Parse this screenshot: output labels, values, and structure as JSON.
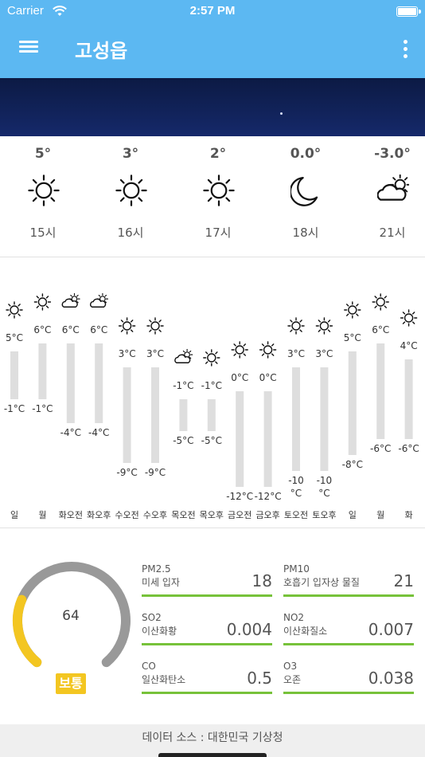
{
  "status": {
    "carrier": "Carrier",
    "time": "2:57 PM"
  },
  "header": {
    "title": "고성읍"
  },
  "hourly": [
    {
      "temp": "5°",
      "icon": "sun-icon",
      "time": "15시"
    },
    {
      "temp": "3°",
      "icon": "sun-icon",
      "time": "16시"
    },
    {
      "temp": "2°",
      "icon": "sun-icon",
      "time": "17시"
    },
    {
      "temp": "0.0°",
      "icon": "moon-icon",
      "time": "18시"
    },
    {
      "temp": "-3.0°",
      "icon": "cloud-sun-icon",
      "time": "21시"
    }
  ],
  "weekly": [
    {
      "label": "일",
      "max": 5,
      "min": -1,
      "max_text": "5°C",
      "min_text": "-1°C",
      "icon": "sun-icon"
    },
    {
      "label": "월",
      "max": 6,
      "min": -1,
      "max_text": "6°C",
      "min_text": "-1°C",
      "icon": "sun-icon"
    },
    {
      "label": "화오전",
      "max": 6,
      "min": -4,
      "max_text": "6°C",
      "min_text": "-4°C",
      "icon": "cloud-sun-icon"
    },
    {
      "label": "화오후",
      "max": 6,
      "min": -4,
      "max_text": "6°C",
      "min_text": "-4°C",
      "icon": "cloud-sun-icon"
    },
    {
      "label": "수오전",
      "max": 3,
      "min": -9,
      "max_text": "3°C",
      "min_text": "-9°C",
      "icon": "sun-icon"
    },
    {
      "label": "수오후",
      "max": 3,
      "min": -9,
      "max_text": "3°C",
      "min_text": "-9°C",
      "icon": "sun-icon"
    },
    {
      "label": "목오전",
      "max": -1,
      "min": -5,
      "max_text": "-1°C",
      "min_text": "-5°C",
      "icon": "cloud-sun-icon"
    },
    {
      "label": "목오후",
      "max": -1,
      "min": -5,
      "max_text": "-1°C",
      "min_text": "-5°C",
      "icon": "sun-icon"
    },
    {
      "label": "금오전",
      "max": 0,
      "min": -12,
      "max_text": "0°C",
      "min_text": "-12°C",
      "icon": "sun-icon"
    },
    {
      "label": "금오후",
      "max": 0,
      "min": -12,
      "max_text": "0°C",
      "min_text": "-12°C",
      "icon": "sun-icon"
    },
    {
      "label": "토오전",
      "max": 3,
      "min": -10,
      "max_text": "3°C",
      "min_text": "-10 °C",
      "icon": "sun-icon"
    },
    {
      "label": "토오후",
      "max": 3,
      "min": -10,
      "max_text": "3°C",
      "min_text": "-10 °C",
      "icon": "sun-icon"
    },
    {
      "label": "일",
      "max": 5,
      "min": -8,
      "max_text": "5°C",
      "min_text": "-8°C",
      "icon": "sun-icon"
    },
    {
      "label": "월",
      "max": 6,
      "min": -6,
      "max_text": "6°C",
      "min_text": "-6°C",
      "icon": "sun-icon"
    },
    {
      "label": "화",
      "max": 4,
      "min": -6,
      "max_text": "4°C",
      "min_text": "-6°C",
      "icon": "sun-icon"
    }
  ],
  "air": {
    "aqi": "64",
    "aqi_fraction": 0.26,
    "grade": "보통",
    "pollutants": [
      {
        "code": "PM2.5",
        "name": "미세 입자",
        "value": "18"
      },
      {
        "code": "PM10",
        "name": "호흡기 입자상 물질",
        "value": "21"
      },
      {
        "code": "SO2",
        "name": "이산화황",
        "value": "0.004"
      },
      {
        "code": "NO2",
        "name": "이산화질소",
        "value": "0.007"
      },
      {
        "code": "CO",
        "name": "일산화탄소",
        "value": "0.5"
      },
      {
        "code": "O3",
        "name": "오존",
        "value": "0.038"
      }
    ]
  },
  "colors": {
    "appbar": "#5cb8f2",
    "bar": "#dedede",
    "pollutant_line": "#77c23a",
    "gauge_track": "#999999",
    "gauge_fill": "#f3c621"
  },
  "footer": {
    "source": "데이터 소스 : 대한민국 기상청"
  }
}
